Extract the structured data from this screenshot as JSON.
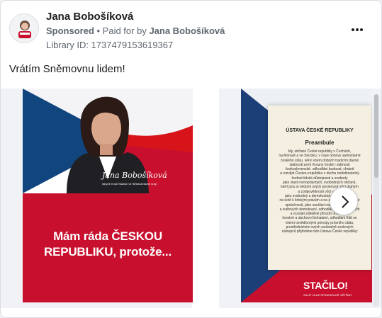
{
  "header": {
    "page_name": "Jana Bobošíková",
    "sponsored_label": "Sponsored",
    "paid_for_prefix": " • Paid for by ",
    "paid_for_name": "Jana Bobošíková",
    "library_id": "Library ID: 1737479153619367",
    "more_icon": "more-horizontal-icon"
  },
  "ad": {
    "primary_text": "Vrátím Sněmovnu lidem!"
  },
  "carousel": {
    "slide1": {
      "signature": "Jana Bobošíková",
      "caption": "lídryně hnutí Stačilo! ve Středočeském kraji",
      "headline_line1": "Mám ráda ČESKOU",
      "headline_line2": "REPUBLIKU, protože..."
    },
    "slide2": {
      "doc_title": "ÚSTAVA ČESKÉ REPUBLIKY",
      "doc_subtitle": "Preambule",
      "doc_lines": [
        "My, občané České republiky v Čechách,",
        "na Moravě a ve Slezsku, v čase obnovy samostatné",
        "českého státu, věrni všem dobrým tradicím dávné",
        "státnosti zemí Koruny české i státnosti",
        "československé, odhodláni budovat, chránit",
        "a rozvíjet Českou republiku v duchu nedotknutelný",
        "hodnot lidské důstojnosti a svobody",
        "jako vlast rovnoprávných, svobodných občanů,",
        "kteří jsou si vědomi svých povinností vůči druhým",
        "a zodpovědnosti vůči celku,",
        "jako svobodný a demokratický stát založený",
        "na úctě k lidským právům a na zásadách občanské",
        "společnosti, jako součást rodiny evropských",
        "a světových demokracií, odhodláni společně střežit",
        "a rozvíjet zděděné přírodní a kulturní,",
        "hmotné a duchovní bohatství, odhodláni řídit se",
        "všemi osvědčenými principy právního státu,",
        "prostřednictvím svých svobodně zvolených",
        "zástupců přijímáme tuto Ústavu České republiky"
      ],
      "logo": "STAČILO!",
      "logo_sub": "SILNÝ HLAS SPRAVEDLNÉ VĚTŠINY"
    },
    "next_icon": "chevron-right-icon"
  },
  "colors": {
    "accent_red": "#c8102e",
    "flag_blue": "#1d3f77",
    "text_secondary": "#606770"
  }
}
